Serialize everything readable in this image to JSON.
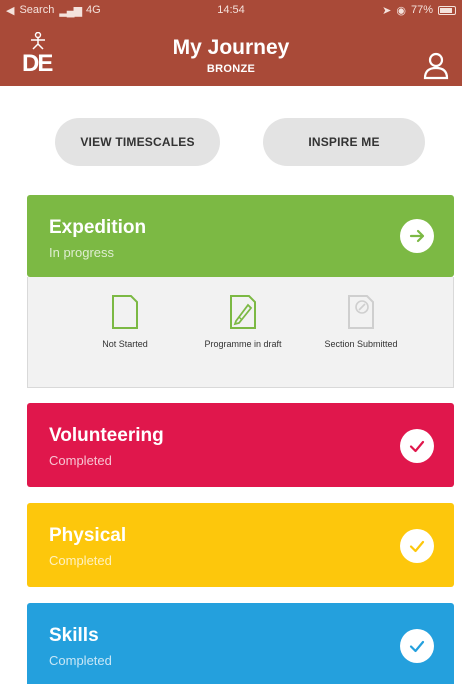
{
  "status_bar": {
    "carrier": "Search",
    "network": "4G",
    "time": "14:54",
    "battery": "77%"
  },
  "header": {
    "logo_text": "DE",
    "title": "My Journey",
    "subtitle": "BRONZE",
    "profile_icon": "person-icon"
  },
  "actions": {
    "timescales_label": "VIEW TIMESCALES",
    "inspire_label": "INSPIRE ME"
  },
  "sections": {
    "expedition": {
      "title": "Expedition",
      "status": "In progress",
      "color": "#7cb944",
      "icon": "arrow-right-icon",
      "steps": [
        {
          "label": "Not Started",
          "icon": "blank-page-icon"
        },
        {
          "label": "Programme in draft",
          "icon": "pencil-page-icon"
        },
        {
          "label": "Section Submitted",
          "icon": "submitted-page-icon"
        }
      ]
    },
    "volunteering": {
      "title": "Volunteering",
      "status": "Completed",
      "color": "#e0174c",
      "icon": "check-icon"
    },
    "physical": {
      "title": "Physical",
      "status": "Completed",
      "color": "#fdc70c",
      "icon": "check-icon"
    },
    "skills": {
      "title": "Skills",
      "status": "Completed",
      "color": "#24a0dd",
      "icon": "check-icon"
    }
  },
  "colors": {
    "header": "#a94a38",
    "pill": "#e3e3e3"
  }
}
